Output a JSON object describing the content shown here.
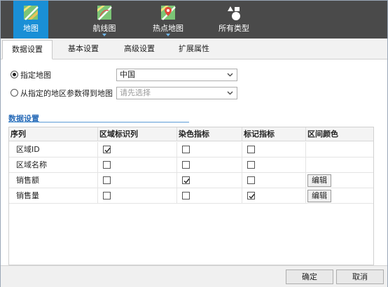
{
  "type_tabs": [
    {
      "label": "地图",
      "icon": "map-icon",
      "active": true
    },
    {
      "label": "航线图",
      "icon": "route-map-icon",
      "active": false
    },
    {
      "label": "热点地图",
      "icon": "hotspot-map-icon",
      "active": false
    },
    {
      "label": "所有类型",
      "icon": "all-types-icon",
      "active": false
    }
  ],
  "settings_tabs": [
    {
      "label": "数据设置",
      "active": true
    },
    {
      "label": "基本设置",
      "active": false
    },
    {
      "label": "高级设置",
      "active": false
    },
    {
      "label": "扩展属性",
      "active": false
    }
  ],
  "map_source": {
    "option_specified": {
      "label": "指定地图",
      "selected": true
    },
    "specified_map_value": "中国",
    "option_from_region": {
      "label": "从指定的地区参数得到地图",
      "selected": false
    },
    "region_param_placeholder": "请先选择"
  },
  "data_section": {
    "title": "数据设置",
    "columns": [
      "序列",
      "区域标识列",
      "染色指标",
      "标记指标",
      "区间颜色"
    ],
    "rows": [
      {
        "name": "区域ID",
        "region_id": true,
        "color_metric": false,
        "mark_metric": false,
        "edit_label": ""
      },
      {
        "name": "区域名称",
        "region_id": false,
        "color_metric": false,
        "mark_metric": false,
        "edit_label": ""
      },
      {
        "name": "销售额",
        "region_id": false,
        "color_metric": true,
        "mark_metric": false,
        "edit_label": "编辑"
      },
      {
        "name": "销售量",
        "region_id": false,
        "color_metric": false,
        "mark_metric": true,
        "edit_label": "编辑"
      }
    ]
  },
  "footer": {
    "ok_label": "确定",
    "cancel_label": "取消"
  },
  "colors": {
    "active_type_tab": "#1a8fd6",
    "type_bar": "#4a4a4a",
    "section_title": "#2a6cb8"
  }
}
